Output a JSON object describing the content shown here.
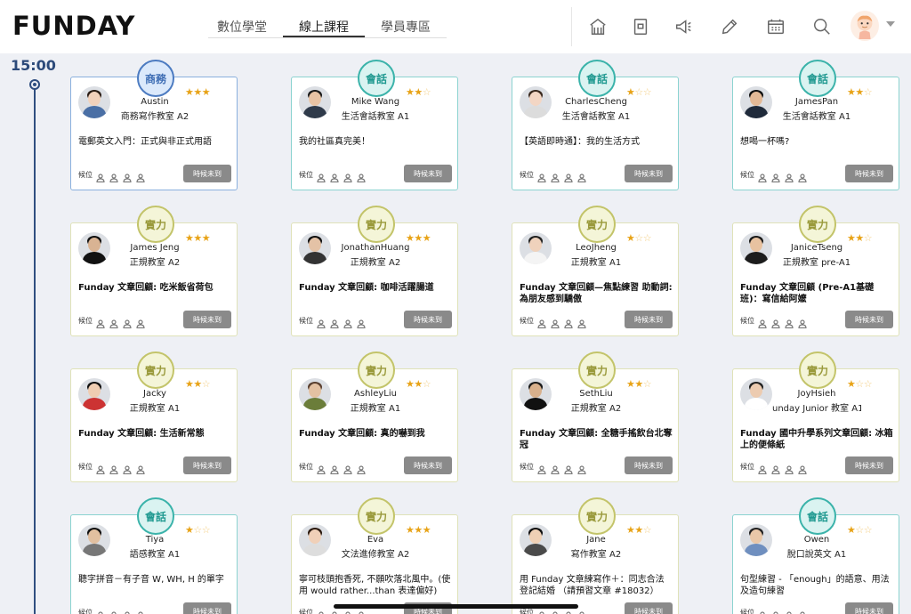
{
  "header": {
    "logo": "FUNDAY",
    "tabs": [
      {
        "label": "數位學堂",
        "active": false
      },
      {
        "label": "線上課程",
        "active": true
      },
      {
        "label": "學員專區",
        "active": false
      }
    ],
    "icons": [
      "home-icon",
      "notebook-icon",
      "megaphone-icon",
      "pencil-icon",
      "calendar-icon",
      "search-icon"
    ]
  },
  "timeline": {
    "time": "15:00"
  },
  "colors": {
    "biz": "#4c7bc1",
    "talk": "#3bb3aa",
    "skill": "#c3c46a",
    "star": "#e8a317",
    "wait_button": "#8a8a8a"
  },
  "cards": [
    {
      "type": "biz",
      "tag": "商務",
      "teacher": "Austin",
      "room": "商務寫作教室 A2",
      "stars": 3,
      "title": "電郵英文入門：正式與非正式用語",
      "title_bold": false,
      "wait_label": "候位",
      "button": "時候未到"
    },
    {
      "type": "talk",
      "tag": "會話",
      "teacher": "Mike Wang",
      "room": "生活會話教室 A1",
      "stars": 2,
      "title": "我的社區真完美！",
      "title_bold": false,
      "wait_label": "候位",
      "button": "時候未到"
    },
    {
      "type": "talk",
      "tag": "會話",
      "teacher": "CharlesCheng",
      "room": "生活會話教室 A1",
      "stars": 1,
      "title": "【英語即時通】：我的生活方式",
      "title_bold": false,
      "wait_label": "候位",
      "button": "時候未到"
    },
    {
      "type": "talk",
      "tag": "會話",
      "teacher": "JamesPan",
      "room": "生活會話教室 A1",
      "stars": 2,
      "title": "想喝一杯嗎?",
      "title_bold": false,
      "wait_label": "候位",
      "button": "時候未到"
    },
    {
      "type": "skill",
      "tag": "實力",
      "teacher": "James Jeng",
      "room": "正規教室 A2",
      "stars": 3,
      "title": "Funday 文章回顧: 吃米飯省荷包",
      "title_bold": true,
      "wait_label": "候位",
      "button": "時候未到"
    },
    {
      "type": "skill",
      "tag": "實力",
      "teacher": "JonathanHuang",
      "room": "正規教室 A2",
      "stars": 3,
      "title": "Funday 文章回顧: 咖啡活躍腸道",
      "title_bold": true,
      "wait_label": "候位",
      "button": "時候未到"
    },
    {
      "type": "skill",
      "tag": "實力",
      "teacher": "LeoJheng",
      "room": "正規教室 A1",
      "stars": 1,
      "title": "Funday 文章回顧—焦點練習 助動詞: 為朋友感到驕傲",
      "title_bold": true,
      "wait_label": "候位",
      "button": "時候未到"
    },
    {
      "type": "skill",
      "tag": "實力",
      "teacher": "JaniceTseng",
      "room": "正規教室 pre-A1",
      "stars": 2,
      "title": "Funday 文章回顧 (Pre-A1基礎班)：寫信給阿嬤",
      "title_bold": true,
      "wait_label": "候位",
      "button": "時候未到"
    },
    {
      "type": "skill",
      "tag": "實力",
      "teacher": "Jacky",
      "room": "正規教室 A1",
      "stars": 2,
      "title": "Funday 文章回顧: 生活新常態",
      "title_bold": true,
      "wait_label": "候位",
      "button": "時候未到"
    },
    {
      "type": "skill",
      "tag": "實力",
      "teacher": "AshleyLiu",
      "room": "正規教室 A1",
      "stars": 2,
      "title": "Funday 文章回顧: 真的嚇到我",
      "title_bold": true,
      "wait_label": "候位",
      "button": "時候未到"
    },
    {
      "type": "skill",
      "tag": "實力",
      "teacher": "SethLiu",
      "room": "正規教室 A2",
      "stars": 2,
      "title": "Funday 文章回顧: 全糖手搖飲台北奪冠",
      "title_bold": true,
      "wait_label": "候位",
      "button": "時候未到"
    },
    {
      "type": "skill",
      "tag": "實力",
      "teacher": "JoyHsieh",
      "room": "unday Junior 教室 A1",
      "stars": 1,
      "title": "Funday 國中升學系列文章回顧: 冰箱上的便條紙",
      "title_bold": true,
      "wait_label": "候位",
      "button": "時候未到"
    },
    {
      "type": "talk",
      "tag": "會話",
      "teacher": "Tiya",
      "room": "語感教室 A1",
      "stars": 1,
      "title": "聽字拼音－有子音 W, WH, H 的單字",
      "title_bold": false,
      "wait_label": "候位",
      "button": "時候未到"
    },
    {
      "type": "skill",
      "tag": "實力",
      "teacher": "Eva",
      "room": "文法進修教室 A2",
      "stars": 3,
      "title": "寧可枝頭抱香死, 不願吹落北風中。(使用 would rather...than 表達偏好)",
      "title_bold": false,
      "wait_label": "候位",
      "button": "時候未到"
    },
    {
      "type": "skill",
      "tag": "實力",
      "teacher": "Jane",
      "room": "寫作教室 A2",
      "stars": 2,
      "title": "用 Funday 文章練寫作＋：同志合法登記結婚 （請預習文章 #18032）",
      "title_bold": false,
      "wait_label": "候位",
      "button": "時候未到"
    },
    {
      "type": "talk",
      "tag": "會話",
      "teacher": "Owen",
      "room": "脫口說英文 A1",
      "stars": 1,
      "title": "句型練習 - 「enough」的語意、用法及造句練習",
      "title_bold": false,
      "wait_label": "候位",
      "button": "時候未到"
    }
  ]
}
